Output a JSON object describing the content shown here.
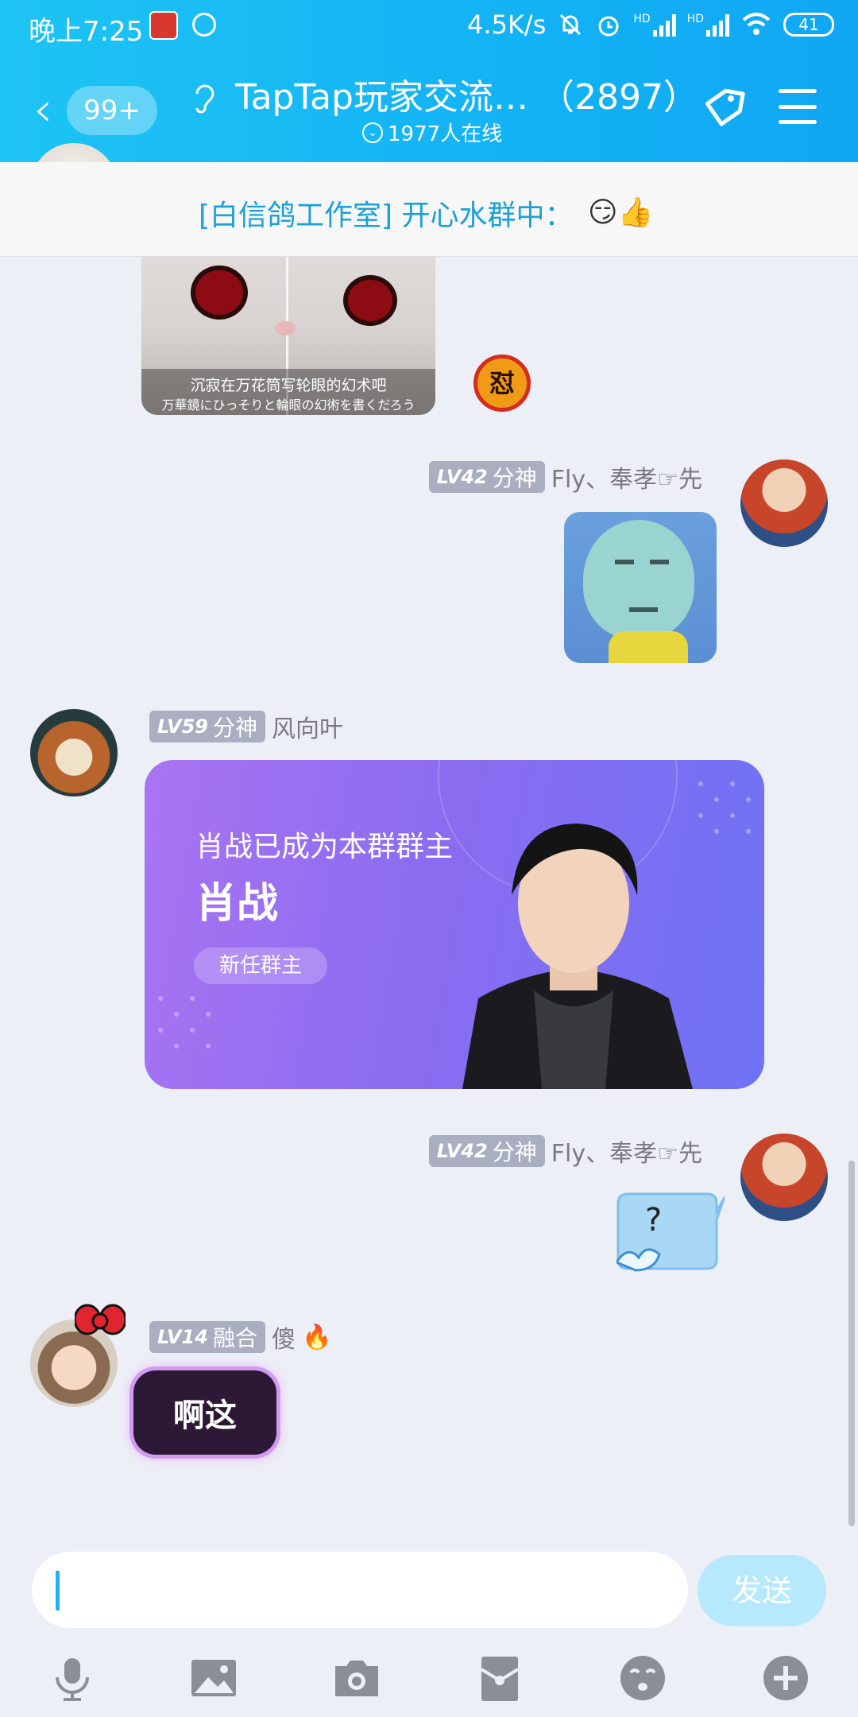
{
  "status_bar": {
    "time": "晚上7:25",
    "net_speed": "4.5K/s",
    "hd1": "HD",
    "hd2": "HD",
    "battery": "41"
  },
  "nav": {
    "unread_count": "99+",
    "title": "TapTap玩家交流… （2897）",
    "online": "1977人在线"
  },
  "notice": {
    "text": "[白信鸽工作室] 开心水群中：",
    "emoji": "😏👍"
  },
  "messages": {
    "m1": {
      "side": "left",
      "image": "cat-sharingan-meme",
      "caption1": "沉寂在万花筒写轮眼的幻术吧",
      "caption2": "万華鏡にひっそりと輪眼の幻術を書くだろう",
      "sticker": "怼"
    },
    "m2": {
      "side": "right",
      "level": "LV42",
      "title": "分神",
      "name": "Fly、奉孝☞先",
      "image": "face-meme"
    },
    "m3": {
      "side": "left",
      "level": "LV59",
      "title": "分神",
      "name": "风向叶",
      "card": {
        "line1": "肖战已成为本群群主",
        "line2": "肖战",
        "pill": "新任群主"
      }
    },
    "m4": {
      "side": "right",
      "level": "LV42",
      "title": "分神",
      "name": "Fly、奉孝☞先",
      "bubble_text": "?"
    },
    "m5": {
      "side": "left",
      "level": "LV14",
      "title": "融合",
      "name": "傻",
      "flair": "🔥",
      "sticker_text": "啊这"
    }
  },
  "input": {
    "placeholder": "",
    "send_label": "发送"
  },
  "toolbar": [
    "mic-icon",
    "image-icon",
    "camera-icon",
    "red-packet-icon",
    "emoji-icon",
    "plus-icon"
  ],
  "colors": {
    "header": "#13b2f5",
    "accent": "#1ba1d8",
    "send_disabled": "#b5e9fb",
    "card_purple": "#8b6cf0"
  }
}
